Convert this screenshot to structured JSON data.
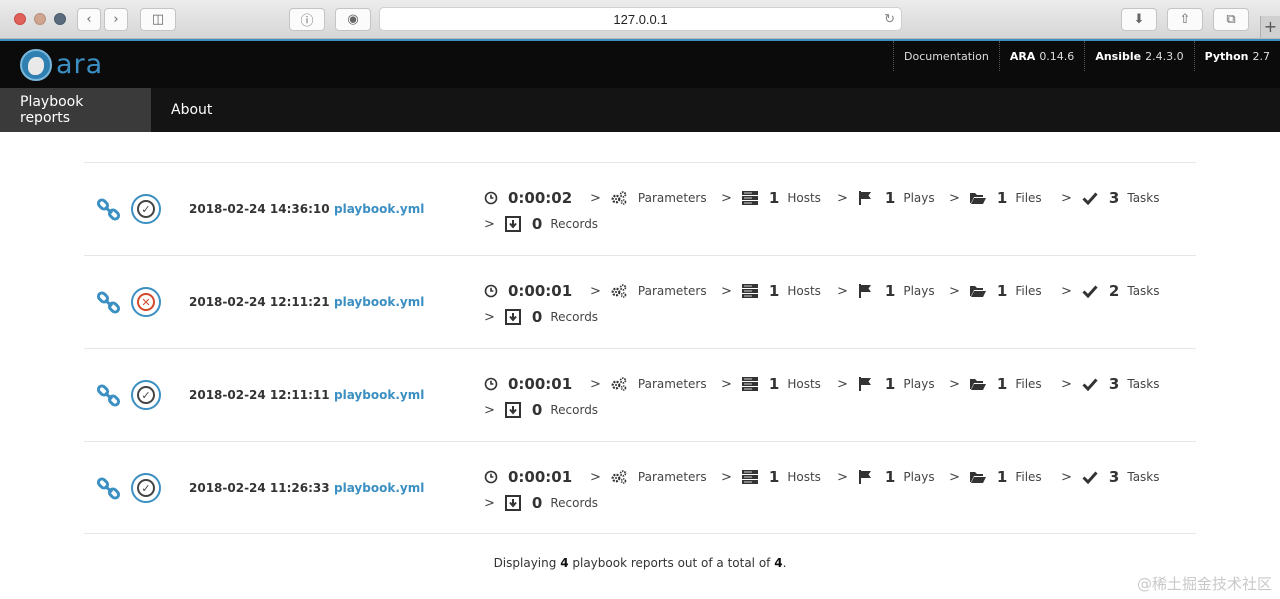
{
  "browser": {
    "url": "127.0.0.1"
  },
  "app": {
    "logo_text": "ara",
    "meta": {
      "documentation": "Documentation",
      "ara_label": "ARA",
      "ara_version": "0.14.6",
      "ansible_label": "Ansible",
      "ansible_version": "2.4.3.0",
      "python_label": "Python",
      "python_version": "2.7"
    },
    "nav": [
      {
        "label": "Playbook reports"
      },
      {
        "label": "About"
      }
    ]
  },
  "labels": {
    "parameters": "Parameters",
    "hosts": "Hosts",
    "plays": "Plays",
    "files": "Files",
    "tasks": "Tasks",
    "records": "Records"
  },
  "reports": [
    {
      "status": "ok",
      "date": "2018-02-24 14:36:10",
      "playbook": "playbook.yml",
      "duration": "0:00:02",
      "hosts": "1",
      "plays": "1",
      "files": "1",
      "tasks": "3",
      "records": "0"
    },
    {
      "status": "failed",
      "date": "2018-02-24 12:11:21",
      "playbook": "playbook.yml",
      "duration": "0:00:01",
      "hosts": "1",
      "plays": "1",
      "files": "1",
      "tasks": "2",
      "records": "0"
    },
    {
      "status": "ok",
      "date": "2018-02-24 12:11:11",
      "playbook": "playbook.yml",
      "duration": "0:00:01",
      "hosts": "1",
      "plays": "1",
      "files": "1",
      "tasks": "3",
      "records": "0"
    },
    {
      "status": "ok",
      "date": "2018-02-24 11:26:33",
      "playbook": "playbook.yml",
      "duration": "0:00:01",
      "hosts": "1",
      "plays": "1",
      "files": "1",
      "tasks": "3",
      "records": "0"
    }
  ],
  "footer": {
    "prefix": "Displaying",
    "count": "4",
    "middle": "playbook reports out of a total of",
    "total": "4",
    "suffix": "."
  },
  "watermark": "@稀土掘金技术社区",
  "colors": {
    "accent": "#3b8fc2",
    "failed": "#d24a2b"
  }
}
